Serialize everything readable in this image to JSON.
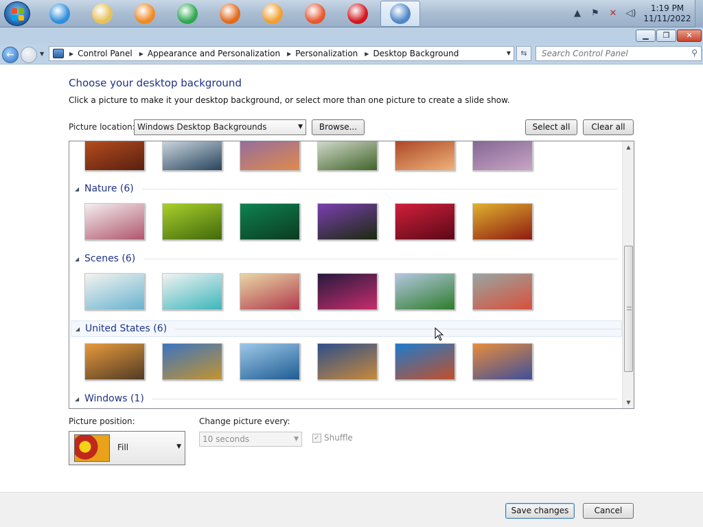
{
  "taskbar": {
    "pinned": [
      {
        "name": "internet-explorer-icon",
        "color": "#2f8fdb"
      },
      {
        "name": "file-explorer-icon",
        "color": "#e7c25a"
      },
      {
        "name": "media-player-icon",
        "color": "#f08a24"
      },
      {
        "name": "chrome-icon",
        "color": "#2fa84f"
      },
      {
        "name": "firefox-icon",
        "color": "#e26a1d"
      },
      {
        "name": "browser-orange-icon",
        "color": "#f0a030"
      },
      {
        "name": "browser-red-icon",
        "color": "#e7582f"
      },
      {
        "name": "opera-icon",
        "color": "#d2171e"
      },
      {
        "name": "control-panel-icon",
        "color": "#4f87c8"
      }
    ],
    "clock": {
      "time": "1:19 PM",
      "date": "11/11/2022"
    }
  },
  "address": {
    "breadcrumbs": [
      "Control Panel",
      "Appearance and Personalization",
      "Personalization",
      "Desktop Background"
    ],
    "search_placeholder": "Search Control Panel"
  },
  "content": {
    "title": "Choose your desktop background",
    "description": "Click a picture to make it your desktop background, or select more than one picture to create a slide show.",
    "picture_location_label": "Picture location:",
    "picture_location_value": "Windows Desktop Backgrounds",
    "browse_label": "Browse...",
    "select_all_label": "Select all",
    "clear_all_label": "Clear all"
  },
  "gallery": {
    "top_row_colors": [
      [
        "#c0531f",
        "#5a1f10"
      ],
      [
        "#dfe8ef",
        "#27445c"
      ],
      [
        "#8a6aa8",
        "#e08a4c"
      ],
      [
        "#e4e8e0",
        "#41642a"
      ],
      [
        "#a33a1c",
        "#f0b27a"
      ],
      [
        "#7b5f8d",
        "#c9a4c6"
      ]
    ],
    "groups": [
      {
        "title": "Nature (6)",
        "thumbs": [
          [
            "#f3eef0",
            "#b0566c"
          ],
          [
            "#a9cf2c",
            "#41690b"
          ],
          [
            "#0e8250",
            "#0b3b22"
          ],
          [
            "#7a3fb0",
            "#1b2a0e"
          ],
          [
            "#d0203a",
            "#5a0818"
          ],
          [
            "#e0b12e",
            "#8e1a10"
          ]
        ]
      },
      {
        "title": "Scenes (6)",
        "thumbs": [
          [
            "#f4f3ef",
            "#68b3cf"
          ],
          [
            "#f2f2f2",
            "#3db6bb"
          ],
          [
            "#e7d7a6",
            "#b23a4c"
          ],
          [
            "#261a3e",
            "#c72d6c"
          ],
          [
            "#b4c6e0",
            "#2d7d2b"
          ],
          [
            "#98a6a2",
            "#d9503b"
          ]
        ]
      },
      {
        "title": "United States (6)",
        "thumbs": [
          [
            "#e79a3c",
            "#503a24"
          ],
          [
            "#3b74c0",
            "#c4942f"
          ],
          [
            "#9dc8e8",
            "#1e5c93"
          ],
          [
            "#2d4f8c",
            "#c8893a"
          ],
          [
            "#1e7acc",
            "#c2502a"
          ],
          [
            "#e88c3c",
            "#3e4f9a"
          ]
        ]
      },
      {
        "title": "Windows (1)",
        "thumbs": []
      }
    ]
  },
  "bottom": {
    "position_label": "Picture position:",
    "position_value": "Fill",
    "change_label": "Change picture every:",
    "change_value": "10 seconds",
    "shuffle_label": "Shuffle",
    "save_label": "Save changes",
    "cancel_label": "Cancel"
  }
}
